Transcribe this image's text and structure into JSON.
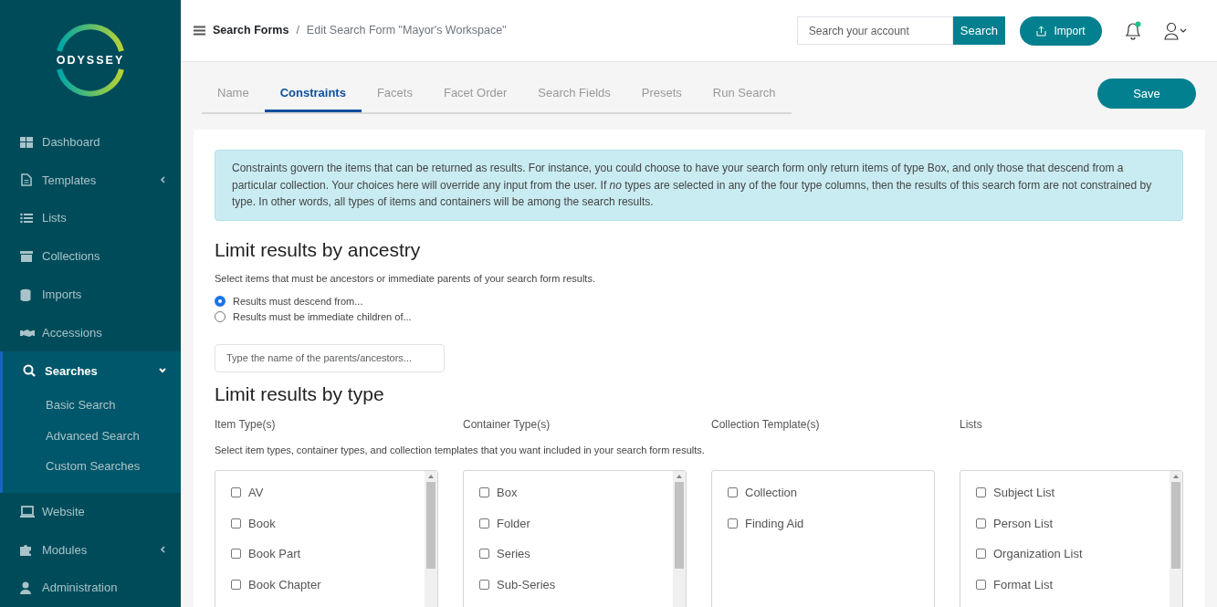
{
  "logo": {
    "text": "ODYSSEY"
  },
  "sidebar": {
    "items": [
      {
        "label": "Dashboard",
        "selected": false
      },
      {
        "label": "Templates",
        "selected": false,
        "expanded": false
      },
      {
        "label": "Lists",
        "selected": false
      },
      {
        "label": "Collections",
        "selected": false
      },
      {
        "label": "Imports",
        "selected": false
      },
      {
        "label": "Accessions",
        "selected": false
      },
      {
        "label": "Searches",
        "selected": true,
        "expanded": true,
        "children": [
          {
            "label": "Basic Search"
          },
          {
            "label": "Advanced Search"
          },
          {
            "label": "Custom Searches"
          }
        ]
      },
      {
        "label": "Website",
        "selected": false
      },
      {
        "label": "Modules",
        "selected": false,
        "expanded": false
      },
      {
        "label": "Administration",
        "selected": false
      }
    ]
  },
  "breadcrumb": [
    {
      "label": "Search Forms"
    },
    {
      "label": "Edit Search Form \"Mayor's Workspace\""
    }
  ],
  "breadcrumb_separator": "/",
  "header": {
    "search_placeholder": "Search your account",
    "search_button": "Search",
    "import_button": "Import",
    "notification": true
  },
  "tabs": [
    {
      "label": "Name",
      "selected": false
    },
    {
      "label": "Constraints",
      "selected": true
    },
    {
      "label": "Facets",
      "selected": false
    },
    {
      "label": "Facet Order",
      "selected": false
    },
    {
      "label": "Search Fields",
      "selected": false
    },
    {
      "label": "Presets",
      "selected": false
    },
    {
      "label": "Run Search",
      "selected": false
    }
  ],
  "save_button": "Save",
  "info": "Constraints govern the items that can be returned as results. For instance, you could choose to have your search form only return items of type Box, and only those that descend from a particular collection. Your choices here will override any input from the user. If *no* types are selected in any of the four type columns, then the results of this search form are not constrained by type. In other words, all types of items and containers will be among the search results.",
  "ancestry": {
    "title": "Limit results by ancestry",
    "help": "Select items that must be ancestors or immediate parents of your search form results.",
    "options": [
      {
        "label": "Results must descend from...",
        "selected": true
      },
      {
        "label": "Results must be immediate children of...",
        "selected": false
      }
    ],
    "placeholder": "Type the name of the parents/ancestors..."
  },
  "types": {
    "title": "Limit results by type",
    "help": "Select item types, container types, and collection templates that you want included in your search form results.",
    "columns": [
      {
        "heading": "Item Type(s)",
        "scrollbar": true,
        "options": [
          {
            "label": "AV",
            "checked": false
          },
          {
            "label": "Book",
            "checked": false
          },
          {
            "label": "Book Part",
            "checked": false
          },
          {
            "label": "Book Chapter",
            "checked": false
          }
        ]
      },
      {
        "heading": "Container Type(s)",
        "scrollbar": true,
        "options": [
          {
            "label": "Box",
            "checked": false
          },
          {
            "label": "Folder",
            "checked": false
          },
          {
            "label": "Series",
            "checked": false
          },
          {
            "label": "Sub-Series",
            "checked": false
          }
        ]
      },
      {
        "heading": "Collection Template(s)",
        "scrollbar": false,
        "options": [
          {
            "label": "Collection",
            "checked": false
          },
          {
            "label": "Finding Aid",
            "checked": false
          }
        ]
      },
      {
        "heading": "Lists",
        "scrollbar": true,
        "options": [
          {
            "label": "Subject List",
            "checked": false
          },
          {
            "label": "Person List",
            "checked": false
          },
          {
            "label": "Organization List",
            "checked": false
          },
          {
            "label": "Format List",
            "checked": false
          }
        ]
      }
    ]
  }
}
